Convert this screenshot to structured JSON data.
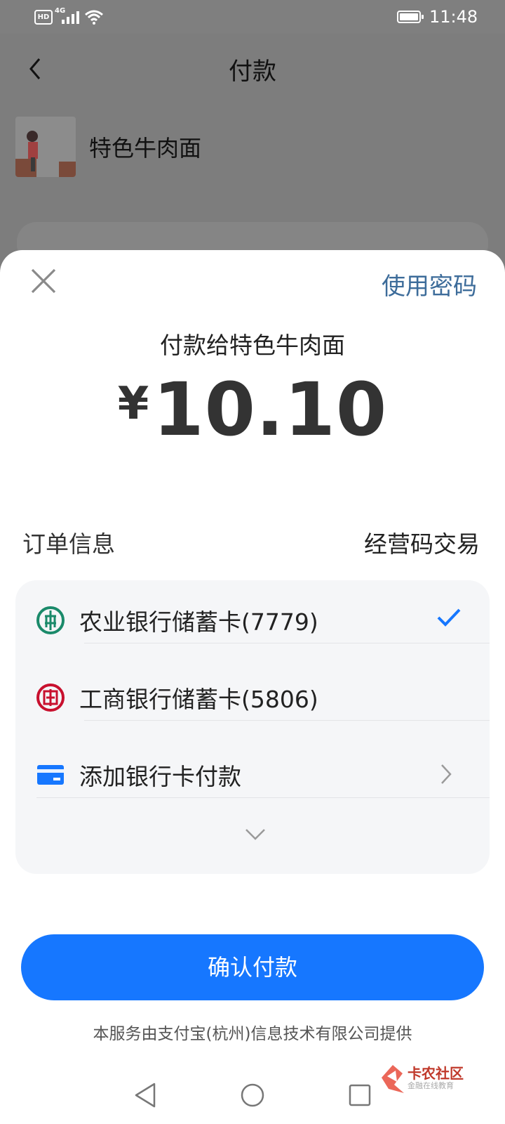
{
  "status_bar": {
    "hd": "HD",
    "network": "4G",
    "time": "11:48"
  },
  "background_page": {
    "title": "付款",
    "merchant_name": "特色牛肉面"
  },
  "sheet": {
    "use_password": "使用密码",
    "pay_to": "付款给特色牛肉面",
    "currency": "¥",
    "amount": "10.10",
    "order_info_label": "订单信息",
    "order_info_value": "经营码交易",
    "payment_methods": [
      {
        "label": "农业银行储蓄卡(7779)",
        "icon": "abc-bank-icon",
        "selected": true
      },
      {
        "label": "工商银行储蓄卡(5806)",
        "icon": "icbc-bank-icon",
        "selected": false
      },
      {
        "label": "添加银行卡付款",
        "icon": "bank-card-icon",
        "selected": false
      }
    ],
    "confirm_button": "确认付款",
    "provider_note": "本服务由支付宝(杭州)信息技术有限公司提供"
  },
  "watermark": {
    "title": "卡农社区",
    "subtitle": "金融在线教育"
  },
  "colors": {
    "primary": "#1677ff",
    "link": "#3d6c9a",
    "abc_green": "#1a8a6a",
    "icbc_red": "#c8102e"
  }
}
